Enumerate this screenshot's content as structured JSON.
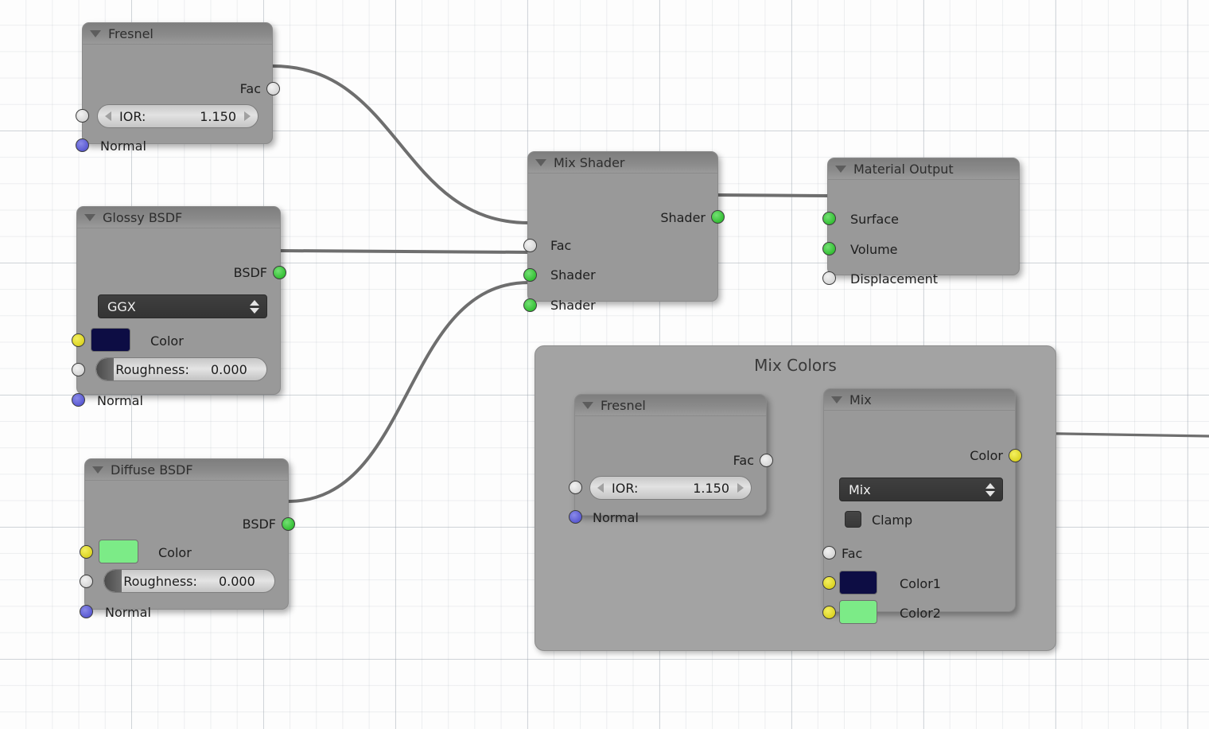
{
  "editor": {
    "name": "blender-shader-node-editor",
    "background_color": "#fdfdfd",
    "grid_color": "#96a0aa",
    "wire_color": "#6e6e6e"
  },
  "socket_colors": {
    "shader": "#35c035",
    "color": "#dcd424",
    "value": "#d6d6d6",
    "vector": "#5a5ad2"
  },
  "nodes": {
    "fresnel_top": {
      "title": "Fresnel",
      "output_fac": "Fac",
      "ior_label": "IOR:",
      "ior_value": "1.150",
      "normal": "Normal"
    },
    "glossy": {
      "title": "Glossy BSDF",
      "output_bsdf": "BSDF",
      "distribution": "GGX",
      "color_label": "Color",
      "color_value": "#0d0d44",
      "roughness_label": "Roughness:",
      "roughness_value": "0.000",
      "normal": "Normal"
    },
    "diffuse": {
      "title": "Diffuse BSDF",
      "output_bsdf": "BSDF",
      "color_label": "Color",
      "color_value": "#7ceb87",
      "roughness_label": "Roughness:",
      "roughness_value": "0.000",
      "normal": "Normal"
    },
    "mix_shader": {
      "title": "Mix Shader",
      "output_shader": "Shader",
      "input_fac": "Fac",
      "input_shader1": "Shader",
      "input_shader2": "Shader"
    },
    "material_output": {
      "title": "Material Output",
      "surface": "Surface",
      "volume": "Volume",
      "displacement": "Displacement"
    },
    "frame_mix_colors": {
      "label": "Mix Colors"
    },
    "fresnel_framed": {
      "title": "Fresnel",
      "output_fac": "Fac",
      "ior_label": "IOR:",
      "ior_value": "1.150",
      "normal": "Normal"
    },
    "mix": {
      "title": "Mix",
      "output_color": "Color",
      "blend_mode": "Mix",
      "clamp_label": "Clamp",
      "clamp_checked": false,
      "input_fac": "Fac",
      "color1_label": "Color1",
      "color1_value": "#0d0d44",
      "color2_label": "Color2",
      "color2_value": "#7ceb87"
    }
  }
}
